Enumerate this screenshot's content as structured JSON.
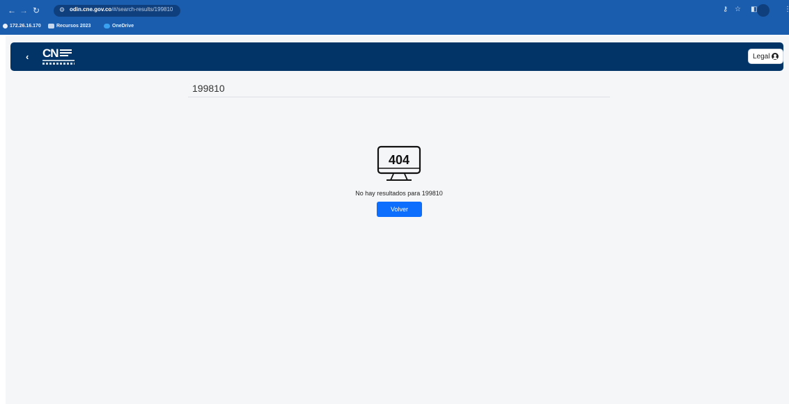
{
  "browser": {
    "url_host": "odin.cne.gov.co",
    "url_path": "/#/search-results/199810",
    "bookmarks": [
      {
        "label": "172.26.16.170",
        "icon": "globe-icon"
      },
      {
        "label": "Recursos 2023",
        "icon": "folder-icon"
      },
      {
        "label": "OneDrive",
        "icon": "cloud-icon"
      }
    ]
  },
  "appbar": {
    "logo_text": "CN",
    "legal_label": "Legal"
  },
  "main": {
    "query": "199810",
    "error_code": "404",
    "message": "No hay resultados para 199810",
    "button_label": "Volver"
  },
  "colors": {
    "chrome": "#1a5cad",
    "appbar": "#023468",
    "accent": "#0d6efd",
    "page_bg": "#f5f6f8"
  }
}
